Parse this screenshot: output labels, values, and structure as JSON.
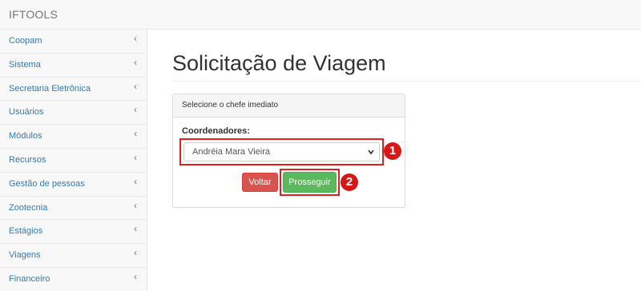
{
  "app": {
    "brand": "IFTOOLS"
  },
  "sidebar": {
    "items": [
      {
        "label": "Coopam"
      },
      {
        "label": "Sistema"
      },
      {
        "label": "Secretaria Eletrônica"
      },
      {
        "label": "Usuários"
      },
      {
        "label": "Módulos"
      },
      {
        "label": "Recursos"
      },
      {
        "label": "Gestão de pessoas"
      },
      {
        "label": "Zootecnia"
      },
      {
        "label": "Estágios"
      },
      {
        "label": "Viagens"
      },
      {
        "label": "Financeiro"
      }
    ],
    "chevron": "‹"
  },
  "main": {
    "title": "Solicitação de Viagem",
    "panel": {
      "heading": "Selecione o chefe imediato",
      "field_label": "Coordenadores:",
      "select_value": "Andréia Mara Vieira",
      "voltar_label": "Voltar",
      "prosseguir_label": "Prosseguir"
    }
  },
  "annotations": {
    "badge_1": "1",
    "badge_2": "2"
  },
  "colors": {
    "link": "#337ab7",
    "danger": "#d9534f",
    "success": "#5cb85c",
    "highlight": "#e02020"
  },
  "icons": {
    "select_arrow": "chevron-down-icon",
    "sidebar_chevron": "chevron-left-icon"
  }
}
